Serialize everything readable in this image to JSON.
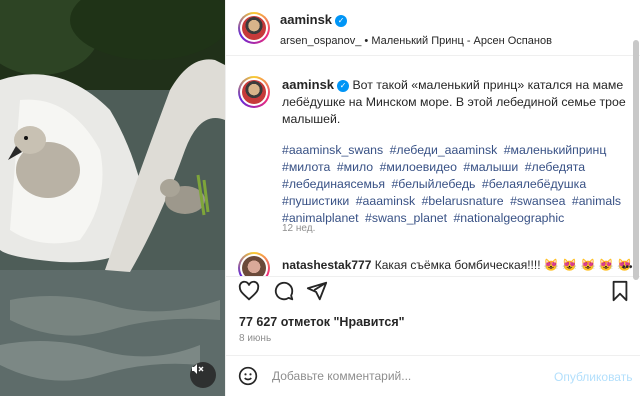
{
  "post_author": {
    "username": "aaminsk",
    "verified_icon": "verified-badge-icon"
  },
  "header_sub": {
    "audio_user": "arsen_ospanov_",
    "separator": "•",
    "audio_track": "Маленький Принц - Арсен Оспанов"
  },
  "caption": {
    "username": "aaminsk",
    "text": "Вот такой «маленький принц» катался на маме лебёдушке на Минском море. В этой лебединой семье трое малышей.",
    "hashtags": [
      "#aaaminsk_swans",
      "#лебеди_aaaminsk",
      "#маленькийпринц",
      "#милота",
      "#мило",
      "#милоевидео",
      "#малыши",
      "#лебедята",
      "#лебединаясемья",
      "#белыйлебедь",
      "#белаялебёдушка",
      "#пушистики",
      "#aaaminsk",
      "#belarusnature",
      "#swansea",
      "#animals",
      "#animalplanet",
      "#swans_planet",
      "#nationalgeographic"
    ],
    "time": "12 нед."
  },
  "comment": {
    "username": "natashestak777",
    "text": "Какая съёмка бомбическая!!!!",
    "emoji": "😻 😻 😻 😻 😻"
  },
  "actions": {
    "likes": "77 627 отметок \"Нравится\"",
    "date": "8 июнь"
  },
  "comment_box": {
    "placeholder": "Добавьте комментарий...",
    "publish_label": "Опубликовать"
  },
  "colors": {
    "accent": "#0095f6",
    "hashtag": "#00376b",
    "muted": "#8e8e8e",
    "publish_disabled": "#b2dffc"
  }
}
